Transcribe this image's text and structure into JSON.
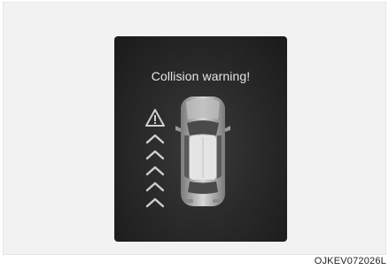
{
  "display": {
    "warning_text": "Collision warning!",
    "icons": [
      "warning-triangle-icon",
      "approach-chevrons-icon",
      "vehicle-top-view-icon"
    ]
  },
  "figure_code": "OJKEV072026L",
  "colors": {
    "screen": "#262626",
    "text": "#e6e6e6",
    "icon": "#cfcfcf"
  }
}
